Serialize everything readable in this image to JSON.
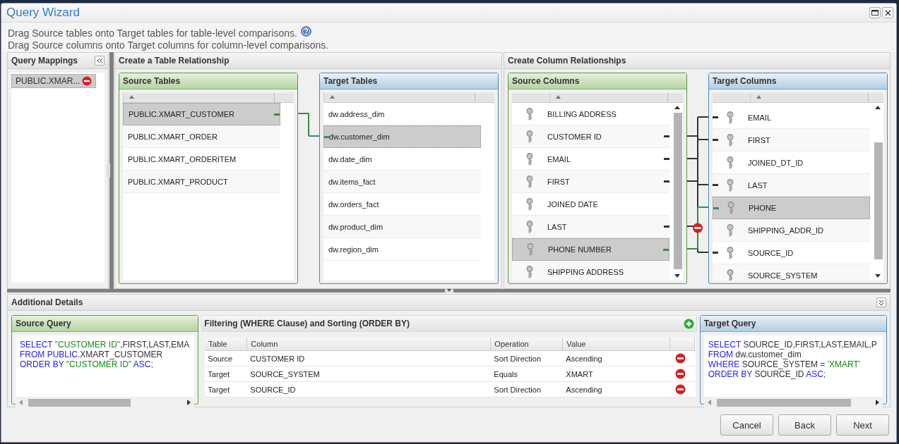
{
  "window": {
    "title": "Query Wizard"
  },
  "instructions": [
    "Drag Source tables onto Target tables for table-level comparisons.",
    "Drag Source columns onto Target columns for column-level comparisons."
  ],
  "query_mappings": {
    "title": "Query Mappings",
    "items": [
      {
        "label": "PUBLIC.XMAR...",
        "selected": true
      }
    ]
  },
  "table_relationship": {
    "title": "Create a Table Relationship",
    "source": {
      "title": "Source Tables",
      "rows": [
        {
          "label": "PUBLIC.XMART_CUSTOMER",
          "selected": true,
          "linked": true
        },
        {
          "label": "PUBLIC.XMART_ORDER",
          "selected": false,
          "linked": false
        },
        {
          "label": "PUBLIC.XMART_ORDERITEM",
          "selected": false,
          "linked": false
        },
        {
          "label": "PUBLIC.XMART_PRODUCT",
          "selected": false,
          "linked": false
        }
      ]
    },
    "target": {
      "title": "Target Tables",
      "rows": [
        {
          "label": "dw.address_dim",
          "selected": false,
          "linked": false
        },
        {
          "label": "dw.customer_dim",
          "selected": true,
          "linked": true
        },
        {
          "label": "dw.date_dim",
          "selected": false,
          "linked": false
        },
        {
          "label": "dw.items_fact",
          "selected": false,
          "linked": false
        },
        {
          "label": "dw.orders_fact",
          "selected": false,
          "linked": false
        },
        {
          "label": "dw.product_dim",
          "selected": false,
          "linked": false
        },
        {
          "label": "dw.region_dim",
          "selected": false,
          "linked": false
        }
      ]
    }
  },
  "column_relationships": {
    "title": "Create Column Relationships",
    "source": {
      "title": "Source Columns",
      "rows": [
        {
          "label": "BILLING ADDRESS",
          "selected": false,
          "linked": false
        },
        {
          "label": "CUSTOMER ID",
          "selected": false,
          "linked": true
        },
        {
          "label": "EMAIL",
          "selected": false,
          "linked": true
        },
        {
          "label": "FIRST",
          "selected": false,
          "linked": true
        },
        {
          "label": "JOINED DATE",
          "selected": false,
          "linked": false
        },
        {
          "label": "LAST",
          "selected": false,
          "linked": true
        },
        {
          "label": "PHONE NUMBER",
          "selected": true,
          "linked": true
        },
        {
          "label": "SHIPPING ADDRESS",
          "selected": false,
          "linked": false
        }
      ]
    },
    "target": {
      "title": "Target Columns",
      "rows": [
        {
          "label": "EMAIL",
          "selected": false,
          "linked": true
        },
        {
          "label": "FIRST",
          "selected": false,
          "linked": true
        },
        {
          "label": "JOINED_DT_ID",
          "selected": false,
          "linked": false
        },
        {
          "label": "LAST",
          "selected": false,
          "linked": true
        },
        {
          "label": "PHONE",
          "selected": true,
          "linked": true
        },
        {
          "label": "SHIPPING_ADDR_ID",
          "selected": false,
          "linked": false
        },
        {
          "label": "SOURCE_ID",
          "selected": false,
          "linked": true
        },
        {
          "label": "SOURCE_SYSTEM",
          "selected": false,
          "linked": false
        }
      ]
    }
  },
  "additional_details": {
    "title": "Additional Details",
    "source_query": {
      "title": "Source Query",
      "lines": [
        [
          {
            "text": "SELECT ",
            "kind": "keyword"
          },
          {
            "text": "\"CUSTOMER ID\"",
            "kind": "string"
          },
          {
            "text": ",FIRST,LAST,EMA",
            "kind": "plain"
          }
        ],
        [
          {
            "text": "FROM PUBLIC",
            "kind": "keyword"
          },
          {
            "text": ".XMART_CUSTOMER",
            "kind": "plain"
          }
        ],
        [
          {
            "text": "ORDER BY ",
            "kind": "keyword"
          },
          {
            "text": "\"CUSTOMER ID\"",
            "kind": "string"
          },
          {
            "text": " ASC",
            "kind": "keyword"
          },
          {
            "text": ";",
            "kind": "plain"
          }
        ]
      ]
    },
    "filtering": {
      "title": "Filtering (WHERE Clause) and Sorting (ORDER BY)",
      "columns": [
        "Table",
        "Column",
        "Operation",
        "Value"
      ],
      "rows": [
        [
          "Source",
          "CUSTOMER ID",
          "Sort Direction",
          "Ascending"
        ],
        [
          "Target",
          "SOURCE_SYSTEM",
          "Equals",
          "XMART"
        ],
        [
          "Target",
          "SOURCE_ID",
          "Sort Direction",
          "Ascending"
        ]
      ]
    },
    "target_query": {
      "title": "Target Query",
      "lines": [
        [
          {
            "text": "SELECT ",
            "kind": "keyword"
          },
          {
            "text": "SOURCE_ID,FIRST,LAST,EMAIL,P",
            "kind": "plain"
          }
        ],
        [
          {
            "text": "FROM ",
            "kind": "keyword"
          },
          {
            "text": "dw.customer_dim",
            "kind": "plain"
          }
        ],
        [
          {
            "text": "WHERE ",
            "kind": "keyword"
          },
          {
            "text": "SOURCE_SYSTEM ",
            "kind": "plain"
          },
          {
            "text": "= ",
            "kind": "keyword"
          },
          {
            "text": "'XMART'",
            "kind": "string"
          }
        ],
        [
          {
            "text": "ORDER BY ",
            "kind": "keyword"
          },
          {
            "text": "SOURCE_ID ",
            "kind": "plain"
          },
          {
            "text": "ASC",
            "kind": "keyword"
          },
          {
            "text": ";",
            "kind": "plain"
          }
        ]
      ]
    }
  },
  "buttons": [
    "Cancel",
    "Back",
    "Next"
  ]
}
